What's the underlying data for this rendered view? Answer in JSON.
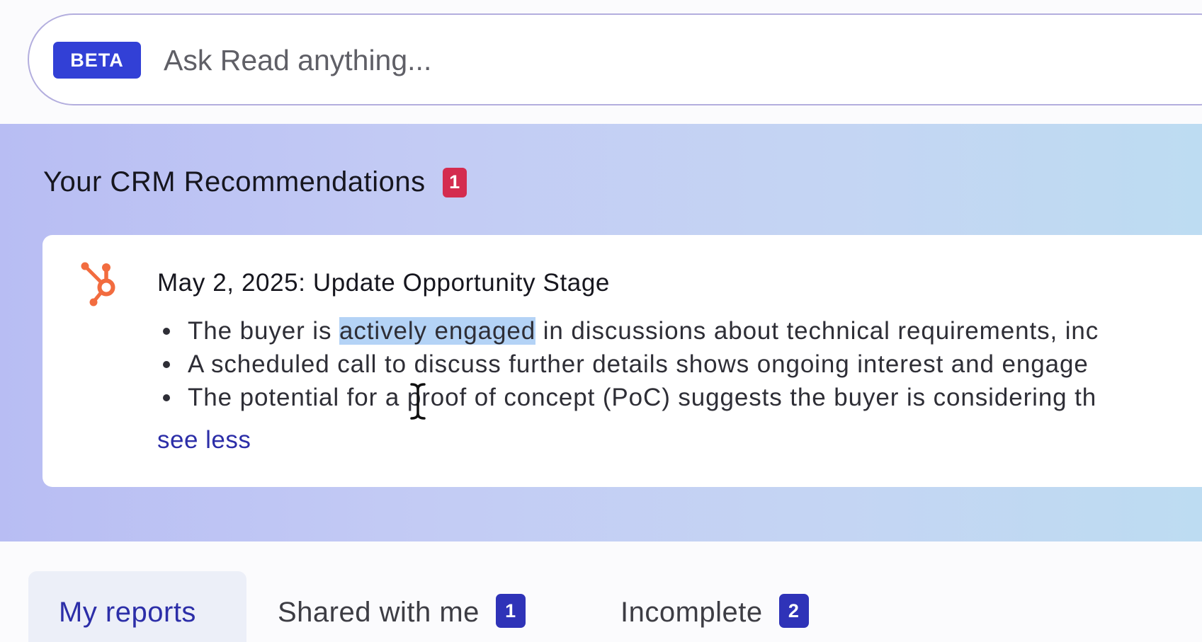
{
  "search": {
    "badge": "BETA",
    "placeholder": "Ask Read anything..."
  },
  "recommendations": {
    "title": "Your CRM Recommendations",
    "count": "1",
    "card": {
      "source_icon": "hubspot-icon",
      "title": "May 2, 2025: Update Opportunity Stage",
      "bullets": [
        {
          "before": "The buyer is ",
          "highlight": "actively engaged",
          "after": " in discussions about technical requirements, inc"
        },
        {
          "text": "A scheduled call to discuss further details shows ongoing interest and engage"
        },
        {
          "text": "The potential for a proof of concept (PoC) suggests the buyer is considering th"
        }
      ],
      "toggle_label": "see less"
    }
  },
  "tabs": [
    {
      "label": "My reports",
      "active": true
    },
    {
      "label": "Shared with me",
      "count": "1"
    },
    {
      "label": "Incomplete",
      "count": "2"
    }
  ],
  "colors": {
    "beta_badge": "#3240d6",
    "alert_badge": "#d42c4f",
    "tab_badge": "#2f33b8",
    "hubspot_orange": "#f26c3f",
    "link": "#2c2ea8",
    "text_selection": "#b4d3f6"
  }
}
